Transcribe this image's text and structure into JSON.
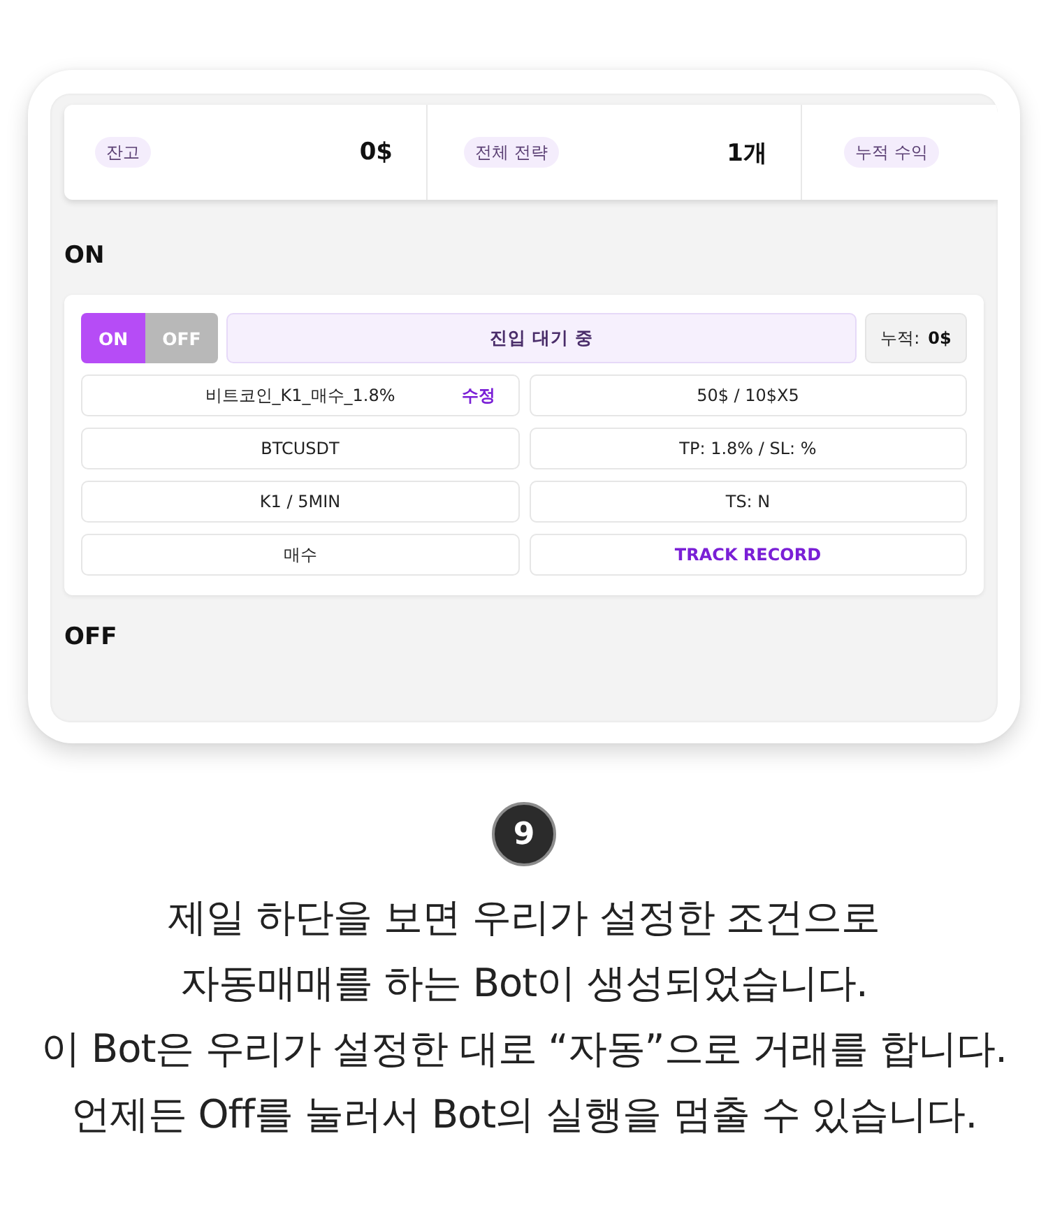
{
  "stats": [
    {
      "label": "잔고",
      "value": "0$"
    },
    {
      "label": "전체 전략",
      "value": "1개"
    },
    {
      "label": "누적 수익"
    }
  ],
  "sections": [
    {
      "title": "ON",
      "bots": [
        {
          "toggle": [
            {
              "label": "ON",
              "selected": true
            },
            {
              "label": "OFF",
              "selected": false
            }
          ],
          "status": "진입 대기 중",
          "profit": {
            "label": "누적:",
            "value": "0$"
          },
          "cells": [
            {
              "kind": "text",
              "text": "비트코인_K1_매수_1.8%",
              "action": "수정"
            },
            {
              "kind": "text",
              "text": "50$ / 10$X5"
            },
            {
              "kind": "text",
              "text": "BTCUSDT"
            },
            {
              "kind": "text",
              "text": "TP: 1.8% / SL: %"
            },
            {
              "kind": "text",
              "text": "K1 / 5MIN"
            },
            {
              "kind": "text",
              "text": "TS: N"
            },
            {
              "kind": "text",
              "text": "매수"
            },
            {
              "kind": "link",
              "text": "TRACK RECORD"
            }
          ]
        }
      ]
    },
    {
      "title": "OFF"
    }
  ],
  "step": "9",
  "caption": [
    "제일 하단을 보면 우리가 설정한 조건으로",
    "자동매매를 하는 Bot이 생성되었습니다.",
    "이 Bot은 우리가 설정한 대로 “자동”으로 거래를 합니다.",
    "언제든 Off를 눌러서 Bot의 실행을 멈출 수 있습니다."
  ]
}
